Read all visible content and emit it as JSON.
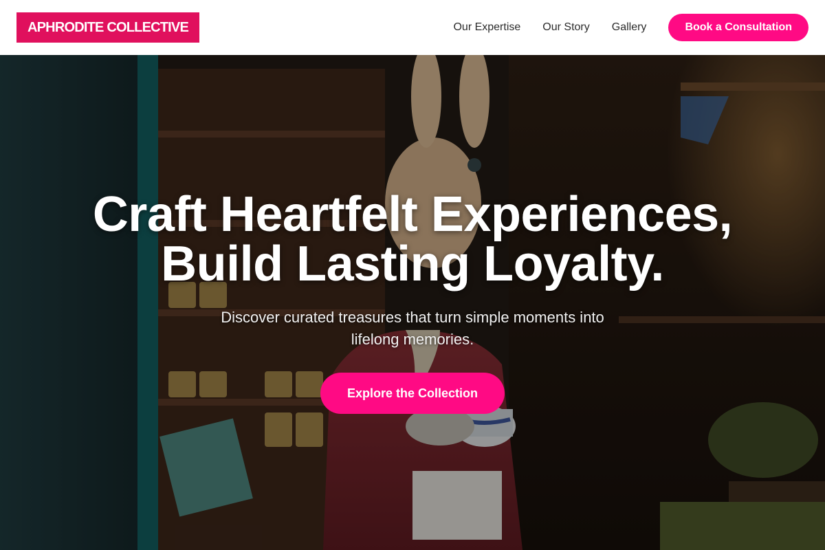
{
  "brand": {
    "logo_text": "APHRODITE COLLECTIVE",
    "accent": "#ff0a84",
    "logo_bg": "#e0105d"
  },
  "nav": {
    "links": [
      {
        "label": "Our Expertise"
      },
      {
        "label": "Our Story"
      },
      {
        "label": "Gallery"
      }
    ],
    "cta_label": "Book a Consultation"
  },
  "hero": {
    "title_line1": "Craft Heartfelt Experiences,",
    "title_line2": "Build Lasting Loyalty.",
    "subtitle": "Discover curated treasures that turn simple moments into lifelong memories.",
    "button_label": "Explore the Collection",
    "background": "photo of a shop interior with a rabbit figure in a red coat holding a teacup"
  }
}
